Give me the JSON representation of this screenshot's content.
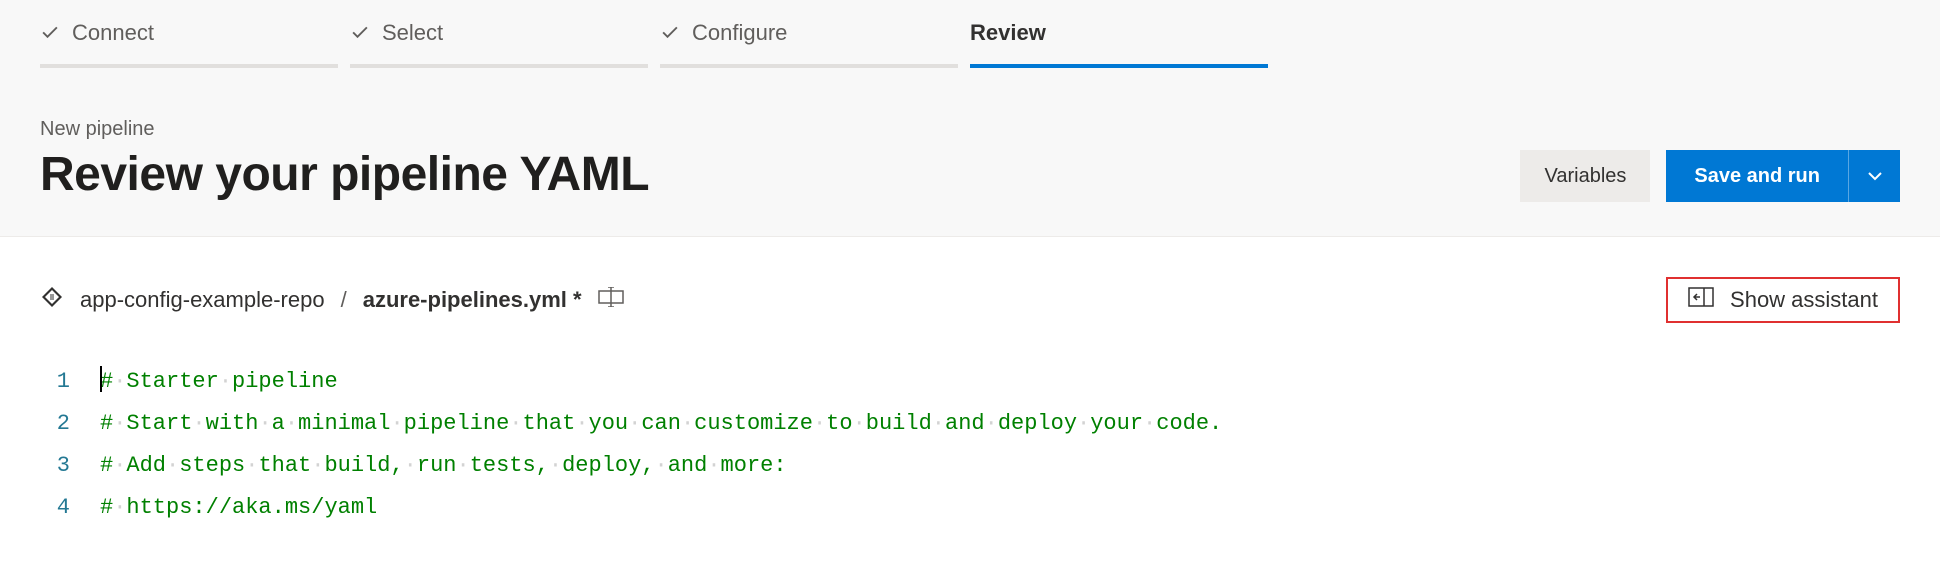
{
  "stepper": {
    "steps": [
      {
        "label": "Connect",
        "done": true,
        "active": false
      },
      {
        "label": "Select",
        "done": true,
        "active": false
      },
      {
        "label": "Configure",
        "done": true,
        "active": false
      },
      {
        "label": "Review",
        "done": false,
        "active": true
      }
    ]
  },
  "subtitle": "New pipeline",
  "title": "Review your pipeline YAML",
  "actions": {
    "variables": "Variables",
    "save_and_run": "Save and run"
  },
  "breadcrumb": {
    "repo": "app-config-example-repo",
    "separator": "/",
    "file": "azure-pipelines.yml *"
  },
  "assistant": {
    "label": "Show assistant"
  },
  "editor": {
    "lines": [
      "# Starter pipeline",
      "# Start with a minimal pipeline that you can customize to build and deploy your code.",
      "# Add steps that build, run tests, deploy, and more:",
      "# https://aka.ms/yaml"
    ],
    "line_numbers": [
      "1",
      "2",
      "3",
      "4"
    ]
  }
}
